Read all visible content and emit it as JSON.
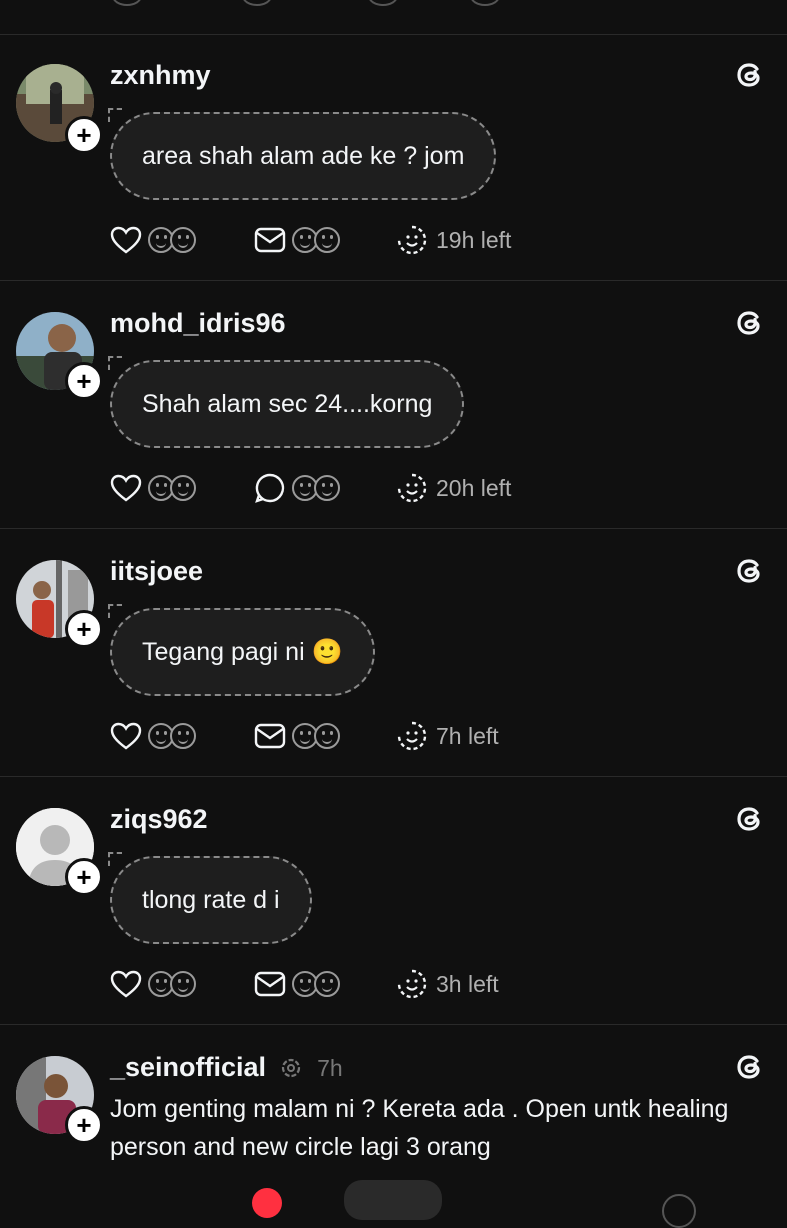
{
  "posts": [
    {
      "username": "zxnhmy",
      "bubble": "area shah alam ade ke ? jom",
      "reply_icon": "envelope-icon",
      "time_left": "19h left"
    },
    {
      "username": "mohd_idris96",
      "bubble": "Shah alam sec 24....korng",
      "reply_icon": "comment-icon",
      "time_left": "20h left"
    },
    {
      "username": "iitsjoee",
      "bubble": "Tegang pagi ni 🙂",
      "reply_icon": "envelope-icon",
      "time_left": "7h left"
    },
    {
      "username": "ziqs962",
      "bubble": "tlong rate d i",
      "reply_icon": "envelope-icon",
      "time_left": "3h left"
    },
    {
      "username": "_seinofficial",
      "time": "7h",
      "text": "Jom genting malam ni ? Kereta ada . Open untk healing person and new circle lagi 3 orang"
    }
  ],
  "colors": {
    "background": "#101010",
    "text": "#f3f5f7",
    "muted": "#9a9a9a",
    "accent_notification": "#ff3040"
  }
}
